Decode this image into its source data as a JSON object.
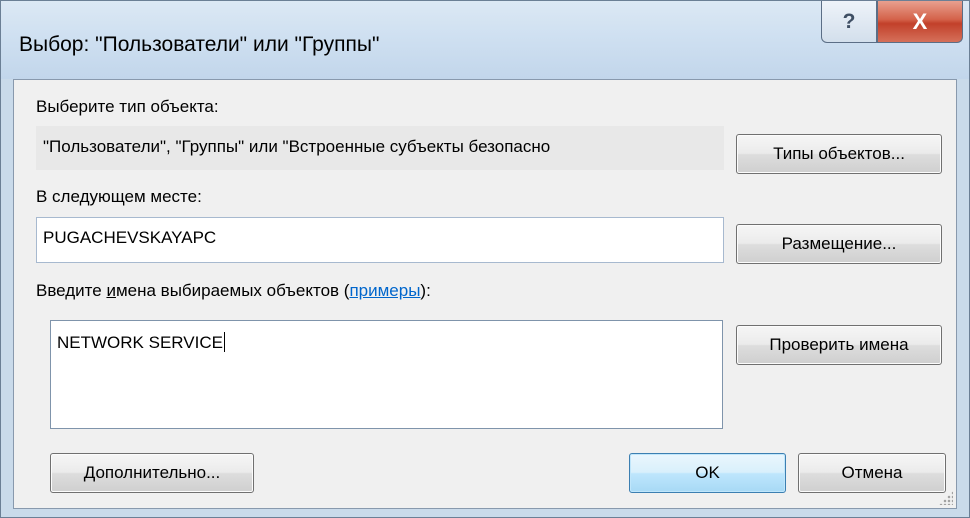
{
  "window": {
    "title": "Выбор: \"Пользователи\" или \"Группы\"",
    "help_glyph": "?",
    "close_glyph": "X"
  },
  "object_type": {
    "label": "Выберите тип объекта:",
    "value": "\"Пользователи\", \"Группы\" или \"Встроенные субъекты безопасно",
    "button": "Типы объектов..."
  },
  "location": {
    "label": "В следующем месте:",
    "value": "PUGACHEVSKAYAPC",
    "button": "Размещение..."
  },
  "names": {
    "label_before": "Введите ",
    "label_accel": "и",
    "label_after": "мена выбираемых объектов (",
    "link": "примеры",
    "label_end": "):",
    "value": "NETWORK SERVICE",
    "check_button": "Проверить имена"
  },
  "footer": {
    "advanced_button": "Дополнительно...",
    "ok_button": "OK",
    "cancel_button": "Отмена"
  }
}
